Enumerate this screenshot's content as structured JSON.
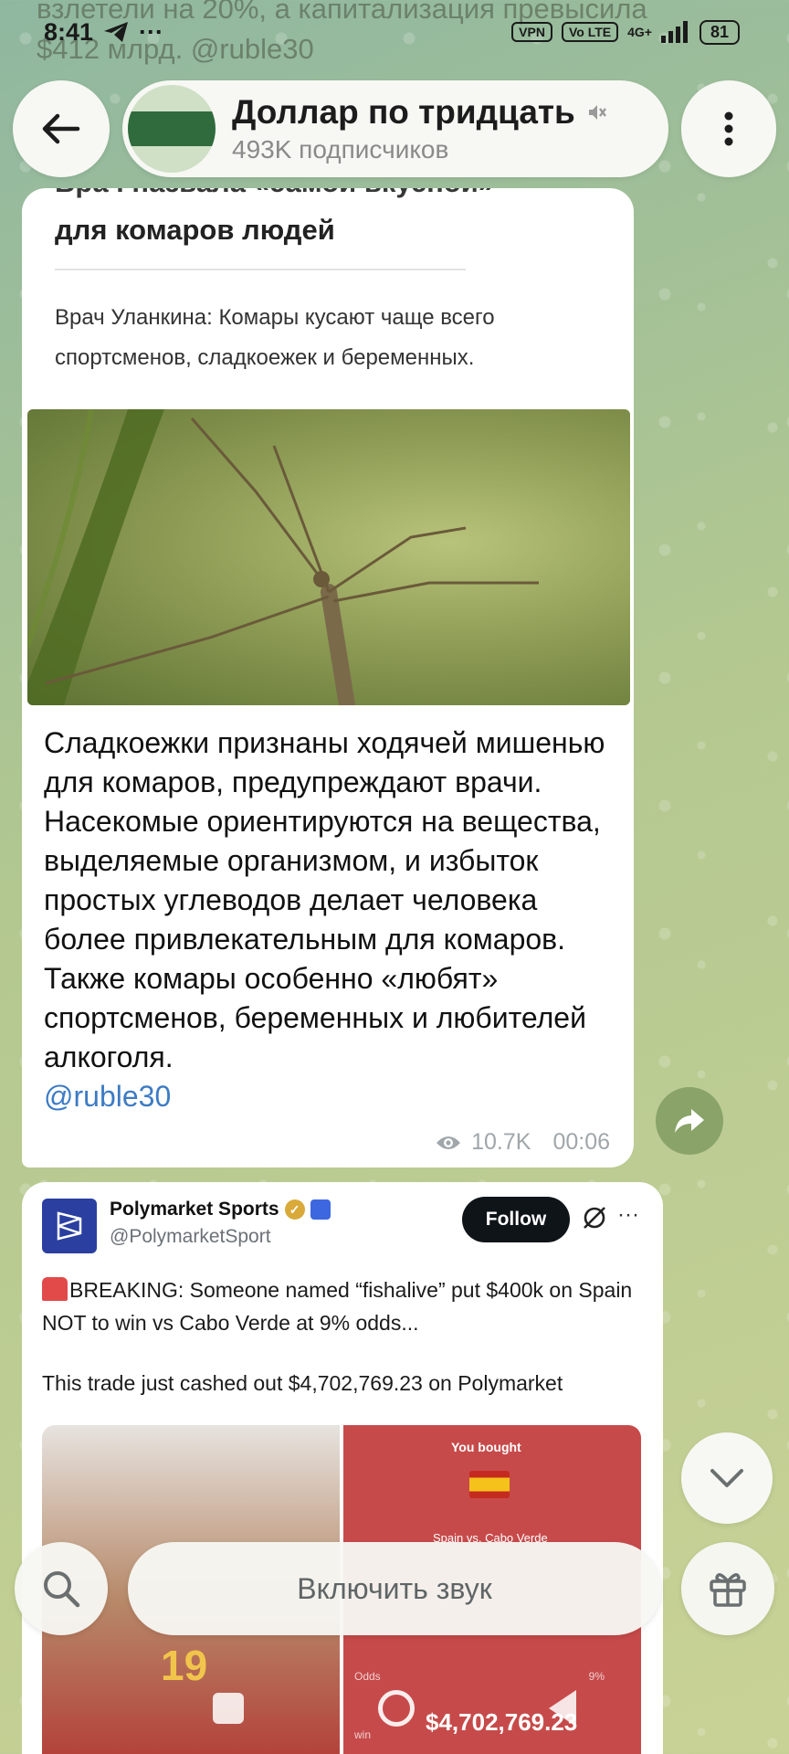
{
  "status_bar": {
    "time": "8:41",
    "vpn": "VPN",
    "volte": "Vo LTE",
    "network": "4G+",
    "battery": "81"
  },
  "prev_post_fragment": "взлетели на 20%, а капитализация превысила $412 млрд. @ruble30",
  "header": {
    "channel_name": "Доллар по тридцать",
    "subscribers": "493K подписчиков",
    "muted": true
  },
  "post1": {
    "article_title_cut": "Врач назвала «самой вкусной»",
    "article_title": "для комаров людей",
    "article_lead": "Врач Уланкина: Комары кусают чаще всего спортсменов, сладкоежек и беременных.",
    "body": "Сладкоежки признаны ходячей мишенью для комаров, предупреждают врачи. Насекомые ориентируются на вещества, выделяемые организмом, и избыток простых углеводов делает человека более привлекательным для комаров. Также комары особенно «любят» спортсменов, беременных и любителей алкоголя.",
    "link": "@ruble30",
    "views": "10.7K",
    "time": "00:06"
  },
  "post2": {
    "account_name": "Polymarket Sports",
    "handle": "@PolymarketSport",
    "follow_label": "Follow",
    "text1": "BREAKING: Someone named “fishalive” put $400k on Spain NOT to win vs Cabo Verde at 9% odds...",
    "text2": "This trade just cashed out $4,702,769.23 on Polymarket",
    "media": {
      "jersey_number": "19",
      "bought_label": "You bought",
      "match": "Spain vs. Cabo Verde",
      "odds_label": "Odds",
      "odds_value": "9%",
      "win_label": "win",
      "payout": "$4,702,769.23"
    }
  },
  "bottom_bar": {
    "unmute_label": "Включить звук"
  },
  "colors": {
    "link": "#3d7bc4",
    "follow_bg": "#0f1419",
    "share_bg": "#7a965a"
  }
}
